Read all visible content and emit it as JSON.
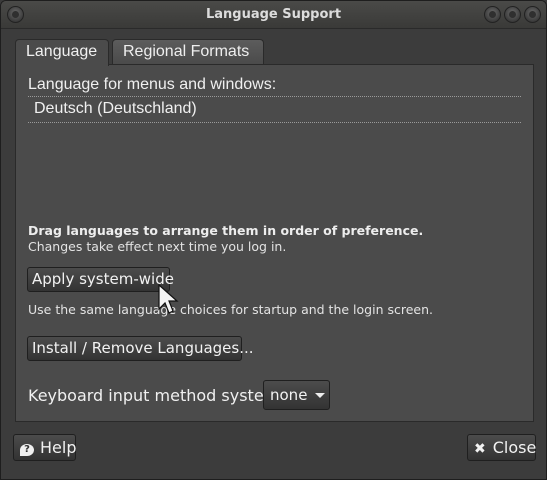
{
  "window": {
    "title": "Language Support"
  },
  "tabs": [
    {
      "label": "Language",
      "active": true
    },
    {
      "label": "Regional Formats",
      "active": false
    }
  ],
  "language": {
    "list_label": "Language for menus and windows:",
    "items": [
      "Deutsch (Deutschland)"
    ],
    "drag_hint": "Drag languages to arrange them in order of preference.",
    "effect_hint": "Changes take effect next time you log in.",
    "apply_button": "Apply system-wide",
    "apply_hint": "Use the same language choices for startup and the login screen.",
    "install_button": "Install / Remove Languages...",
    "keyboard_label": "Keyboard input method system:",
    "keyboard_value": "none"
  },
  "footer": {
    "help_label": "Help",
    "close_label": "Close"
  },
  "colors": {
    "background": "#3c3c3c",
    "panel": "#4b4b4b",
    "text": "#f0f0f0"
  }
}
